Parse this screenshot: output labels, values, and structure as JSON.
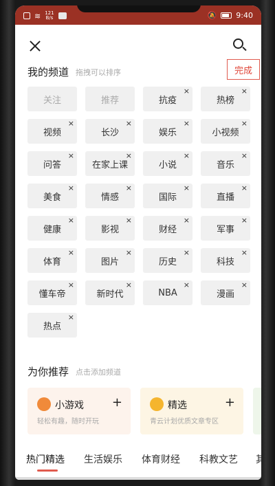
{
  "status_bar": {
    "netspeed_value": "121",
    "netspeed_unit": "B/s",
    "time": "9:40"
  },
  "my_channels": {
    "title": "我的频道",
    "hint": "拖拽可以排序",
    "done_label": "完成",
    "items": [
      {
        "label": "关注",
        "removable": false
      },
      {
        "label": "推荐",
        "removable": false
      },
      {
        "label": "抗疫",
        "removable": true
      },
      {
        "label": "热榜",
        "removable": true
      },
      {
        "label": "视频",
        "removable": true
      },
      {
        "label": "长沙",
        "removable": true
      },
      {
        "label": "娱乐",
        "removable": true
      },
      {
        "label": "小视频",
        "removable": true
      },
      {
        "label": "问答",
        "removable": true
      },
      {
        "label": "在家上课",
        "removable": true
      },
      {
        "label": "小说",
        "removable": true
      },
      {
        "label": "音乐",
        "removable": true
      },
      {
        "label": "美食",
        "removable": true
      },
      {
        "label": "情感",
        "removable": true
      },
      {
        "label": "国际",
        "removable": true
      },
      {
        "label": "直播",
        "removable": true
      },
      {
        "label": "健康",
        "removable": true
      },
      {
        "label": "影视",
        "removable": true
      },
      {
        "label": "财经",
        "removable": true
      },
      {
        "label": "军事",
        "removable": true
      },
      {
        "label": "体育",
        "removable": true
      },
      {
        "label": "图片",
        "removable": true
      },
      {
        "label": "历史",
        "removable": true
      },
      {
        "label": "科技",
        "removable": true
      },
      {
        "label": "懂车帝",
        "removable": true
      },
      {
        "label": "新时代",
        "removable": true
      },
      {
        "label": "NBA",
        "removable": true
      },
      {
        "label": "漫画",
        "removable": true
      },
      {
        "label": "热点",
        "removable": true
      }
    ],
    "remove_glyph": "×"
  },
  "recommend": {
    "title": "为你推荐",
    "hint": "点击添加频道",
    "cards": [
      {
        "name": "小游戏",
        "desc": "轻松有趣，随时开玩",
        "plus": "+",
        "bg": "#fdf3ec",
        "logo_color": "#f08a3a",
        "logo_icon": "game-icon"
      },
      {
        "name": "精选",
        "desc": "青云计划优质文章专区",
        "plus": "+",
        "bg": "#fdf5e4",
        "logo_color": "#f5b52e",
        "logo_icon": "crown-icon"
      }
    ]
  },
  "category_tabs": [
    {
      "label": "热门精选",
      "active": true
    },
    {
      "label": "生活娱乐",
      "active": false
    },
    {
      "label": "体育财经",
      "active": false
    },
    {
      "label": "科教文艺",
      "active": false
    },
    {
      "label": "其",
      "active": false
    }
  ],
  "colors": {
    "status_bar": "#9b3124",
    "accent": "#e05a4e",
    "chip_bg": "#f0f0f0"
  }
}
